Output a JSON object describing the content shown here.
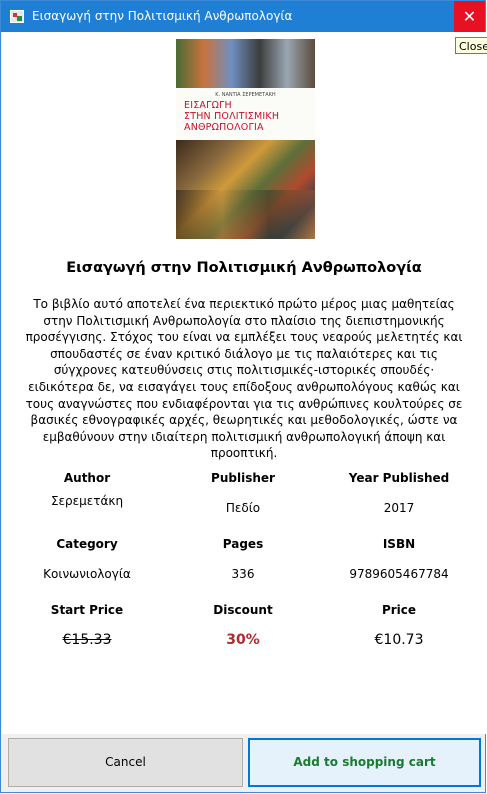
{
  "window": {
    "title": "Εισαγωγή στην Πολιτισμική Ανθρωπολογία",
    "close_glyph": "✕",
    "close_tooltip": "Close"
  },
  "book": {
    "cover": {
      "author_text": "Κ. ΝΑΝΤΙΑ ΣΕΡΕΜΕΤΑΚΗ",
      "title_lines": [
        "ΕΙΣΑΓΩΓΗ",
        "ΣΤΗΝ ΠΟΛΙΤΙΣΜΙΚΗ",
        "ΑΝΘΡΩΠΟΛΟΓΙΑ"
      ]
    },
    "title": "Εισαγωγή στην Πολιτισμική Ανθρωπολογία",
    "description": "Το βιβλίο αυτό αποτελεί ένα περιεκτικό πρώτο μέρος μιας μαθητείας στην Πολιτισμική Ανθρωπολογία στο πλαίσιο της διεπιστημονικής προσέγγισης. Στόχος του είναι να εμπλέξει τους νεαρούς μελετητές και σπουδαστές σε έναν κριτικό διάλογο με τις παλαιότερες και τις σύγχρονες κατευθύνσεις στις πολιτισμικές-ιστορικές σπουδές· ειδικότερα δε, να εισαγάγει τους επίδοξους ανθρωπολόγους καθώς και τους αναγνώστες που ενδιαφέρονται για τις ανθρώπινες κουλτούρες σε βασικές εθνογραφικές αρχές, θεωρητικές και μεθοδολογικές, ώστε να εμβαθύνουν στην ιδιαίτερη πολιτισμική ανθρωπολογική άποψη και προοπτική."
  },
  "details": {
    "author_label": "Author",
    "author_value": "Σερεμετάκη",
    "publisher_label": "Publisher",
    "publisher_value": "Πεδίο",
    "year_label": "Year Published",
    "year_value": "2017",
    "category_label": "Category",
    "category_value": "Κοινωνιολογία",
    "pages_label": "Pages",
    "pages_value": "336",
    "isbn_label": "ISBN",
    "isbn_value": "9789605467784",
    "start_price_label": "Start Price",
    "start_price_value": "€15.33",
    "discount_label": "Discount",
    "discount_value": "30%",
    "price_label": "Price",
    "price_value": "€10.73"
  },
  "buttons": {
    "cancel": "Cancel",
    "add_to_cart": "Add to shopping cart"
  },
  "colors": {
    "titlebar": "#1f7fd4",
    "close_button": "#e81123",
    "discount": "#b2292e",
    "add_to_cart_text": "#1b7a32",
    "add_to_cart_border": "#0078d7"
  }
}
